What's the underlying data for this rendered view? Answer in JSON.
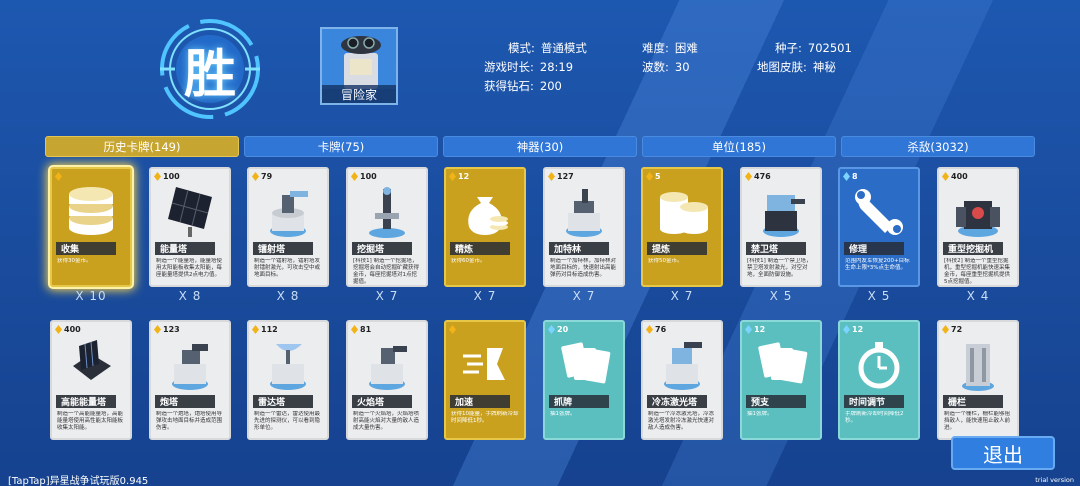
{
  "victory": {
    "label": "胜"
  },
  "player": {
    "name": "冒险家"
  },
  "stats": {
    "mode_label": "模式:",
    "mode": "普通模式",
    "time_label": "游戏时长:",
    "time": "28:19",
    "diamonds_label": "获得钻石:",
    "diamonds": "200",
    "difficulty_label": "难度:",
    "difficulty": "困难",
    "waves_label": "波数:",
    "waves": "30",
    "seed_label": "种子:",
    "seed": "702501",
    "skin_label": "地图皮肤:",
    "skin": "神秘"
  },
  "tabs": [
    {
      "label": "历史卡牌(149)",
      "active": true
    },
    {
      "label": "卡牌(75)",
      "active": false
    },
    {
      "label": "神器(30)",
      "active": false
    },
    {
      "label": "单位(185)",
      "active": false
    },
    {
      "label": "杀敌(3032)",
      "active": false
    }
  ],
  "cards": [
    {
      "name": "收集",
      "cost": "",
      "style": "gold",
      "icon": "coins-icon",
      "desc": "获得30金币。",
      "count": "X 10",
      "selected": true
    },
    {
      "name": "能量塔",
      "cost": "100",
      "style": "white",
      "icon": "solar-panel-icon",
      "desc": "制造一个能量塔，能量塔使用太阳能板收集太阳能，每座能量塔提供2点电力值。",
      "count": "X 8"
    },
    {
      "name": "镭射塔",
      "cost": "79",
      "style": "white",
      "icon": "laser-tower-icon",
      "desc": "制造一个镭射塔，镭射塔发射镭射激光，可攻击空中或地面目标。",
      "count": "X 8"
    },
    {
      "name": "挖掘塔",
      "cost": "100",
      "style": "white",
      "icon": "drill-tower-icon",
      "desc": "[科技1] 制造一个挖掘塔，挖掘塔会自动挖掘矿藏获得金币，每座挖掘塔对1点挖掘值。",
      "count": "X 7"
    },
    {
      "name": "精炼",
      "cost": "12",
      "style": "gold",
      "icon": "money-bag-icon",
      "desc": "获得60金币。",
      "count": "X 7"
    },
    {
      "name": "加特林",
      "cost": "127",
      "style": "white",
      "icon": "gatling-icon",
      "desc": "制造一个加特林，加特林对地面目标的，快速射出高能弹药对目标造成伤害。",
      "count": "X 7"
    },
    {
      "name": "提炼",
      "cost": "5",
      "style": "gold",
      "icon": "coin-stack-icon",
      "desc": "获得50金币。",
      "count": "X 7"
    },
    {
      "name": "禁卫塔",
      "cost": "476",
      "style": "white",
      "icon": "guard-tower-icon",
      "desc": "[科技1] 制造一个禁卫塔，禁卫塔发射激光，对空对地，全面防御设施。",
      "count": "X 5"
    },
    {
      "name": "修理",
      "cost": "8",
      "style": "blue",
      "icon": "wrench-icon",
      "desc": "范围内友军恢复200+目标生命上限*3%点生命值。",
      "count": "X 5"
    },
    {
      "name": "重型挖掘机",
      "cost": "400",
      "style": "white",
      "icon": "excavator-icon",
      "desc": "[科技2] 制造一个重型挖掘机，重型挖掘机能快速采集金币，每座重型挖掘机提供5点挖掘值。",
      "count": "X 4"
    },
    {
      "name": "高能能量塔",
      "cost": "400",
      "style": "white",
      "icon": "solar-array-icon",
      "desc": "制造一个高能能量塔，高能能量塔使用高性能太阳能板收集太阳能。",
      "count": ""
    },
    {
      "name": "炮塔",
      "cost": "123",
      "style": "white",
      "icon": "cannon-icon",
      "desc": "制造一个炮塔，炮塔使用导弹攻击地面目标并造成范围伤害。",
      "count": ""
    },
    {
      "name": "雷达塔",
      "cost": "112",
      "style": "white",
      "icon": "radar-icon",
      "desc": "制造一个雷达，雷达使用最先进的探测仪，可以看到隐形单位。",
      "count": ""
    },
    {
      "name": "火焰塔",
      "cost": "81",
      "style": "white",
      "icon": "flame-tower-icon",
      "desc": "制造一个火焰塔，火焰塔喷射高能火焰对大量的敌人造成大量伤害。",
      "count": ""
    },
    {
      "name": "加速",
      "cost": "",
      "style": "gold",
      "icon": "speed-icon",
      "desc": "获得10能量，手牌刷新冷却时间降低1秒。",
      "count": ""
    },
    {
      "name": "抓牌",
      "cost": "20",
      "style": "teal",
      "icon": "cards-icon",
      "desc": "抽1张牌。",
      "count": ""
    },
    {
      "name": "冷冻激光塔",
      "cost": "76",
      "style": "white",
      "icon": "freeze-laser-icon",
      "desc": "制造一个冷冻激光塔，冷冻激光塔发射冷冻激光快速对敌人造成伤害。",
      "count": ""
    },
    {
      "name": "预支",
      "cost": "12",
      "style": "teal",
      "icon": "cards-icon",
      "desc": "抽1张牌。",
      "count": ""
    },
    {
      "name": "时间调节",
      "cost": "12",
      "style": "teal",
      "icon": "stopwatch-icon",
      "desc": "手牌刷新冷却时间降低2秒。",
      "count": ""
    },
    {
      "name": "栅栏",
      "cost": "72",
      "style": "white",
      "icon": "fence-icon",
      "desc": "制造一个栅栏，栅栏能够阻挡敌人，能快速阻止敌人前进。",
      "count": ""
    }
  ],
  "exit": {
    "label": "退出"
  },
  "footer": {
    "version": "[TapTap]异星战争试玩版0.945",
    "trial": "trial version"
  }
}
